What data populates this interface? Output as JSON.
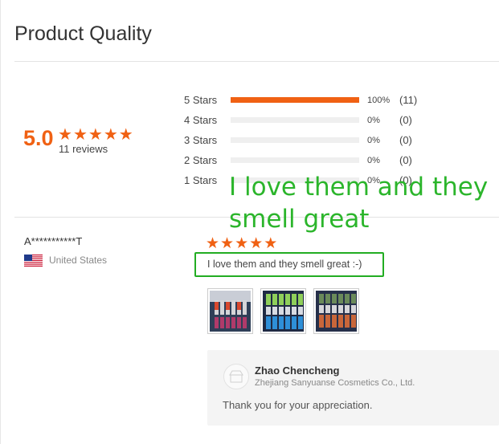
{
  "header": {
    "title": "Product Quality"
  },
  "rating_summary": {
    "score": "5.0",
    "stars_filled": 5,
    "reviews_label": "11 reviews",
    "accent_color": "#f06113"
  },
  "histogram": [
    {
      "label": "5 Stars",
      "percent_text": "100%",
      "count_text": "(11)",
      "fill_fraction": 1.0
    },
    {
      "label": "4 Stars",
      "percent_text": "0%",
      "count_text": "(0)",
      "fill_fraction": 0
    },
    {
      "label": "3 Stars",
      "percent_text": "0%",
      "count_text": "(0)",
      "fill_fraction": 0
    },
    {
      "label": "2 Stars",
      "percent_text": "0%",
      "count_text": "(0)",
      "fill_fraction": 0
    },
    {
      "label": "1 Stars",
      "percent_text": "0%",
      "count_text": "(0)",
      "fill_fraction": 0
    }
  ],
  "overlay_caption": "I love them and they smell great",
  "review": {
    "reviewer": "A***********T",
    "country": "United States",
    "flag_icon": "us-flag-icon",
    "stars_filled": 5,
    "text": "I love them and they smell great :-)",
    "highlight_color": "#22ad22",
    "photos": [
      "review-photo-1",
      "review-photo-2",
      "review-photo-3"
    ]
  },
  "seller_reply": {
    "name": "Zhao Chencheng",
    "company": "Zhejiang Sanyuanse Cosmetics Co., Ltd.",
    "text": "Thank you for your appreciation."
  }
}
